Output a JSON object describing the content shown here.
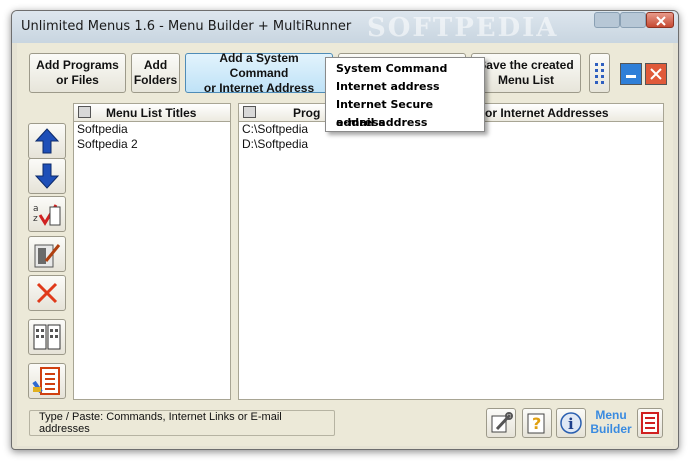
{
  "window": {
    "title": "Unlimited Menus 1.6 - Menu Builder + MultiRunner",
    "watermark": "SOFTPEDIA"
  },
  "toolbar": {
    "add_programs": "Add Programs\nor Files",
    "add_folders": "Add\nFolders",
    "add_system_command": "Add a System Command\nor Internet Address",
    "save_menu_list": "Save the created\nMenu List"
  },
  "dropdown_menu": {
    "items": [
      "System Command",
      "Internet address",
      "Internet Secure address",
      "e-mail address"
    ]
  },
  "left_panel": {
    "header": "Menu List Titles",
    "items": [
      "Softpedia",
      "Softpedia 2"
    ]
  },
  "right_panel": {
    "header_left": "Prog",
    "header_right": "or Internet Addresses",
    "items": [
      "C:\\Softpedia",
      "D:\\Softpedia"
    ]
  },
  "status": {
    "text": "Type / Paste: Commands, Internet Links or E-mail addresses"
  },
  "bottom": {
    "menu_builder_label": "Menu\nBuilder"
  },
  "colors": {
    "hover_button": "#bfe2f7",
    "menu_builder_text": "#3a8be0",
    "arrow_blue": "#1e4fb8",
    "delete_red": "#e03a1a"
  },
  "icons": [
    "move-up-arrow-icon",
    "move-down-arrow-icon",
    "sort-icon",
    "edit-icon",
    "delete-icon",
    "columns-icon",
    "menu-list-icon",
    "wrench-icon",
    "help-icon",
    "info-icon",
    "menu-builder-icon"
  ]
}
